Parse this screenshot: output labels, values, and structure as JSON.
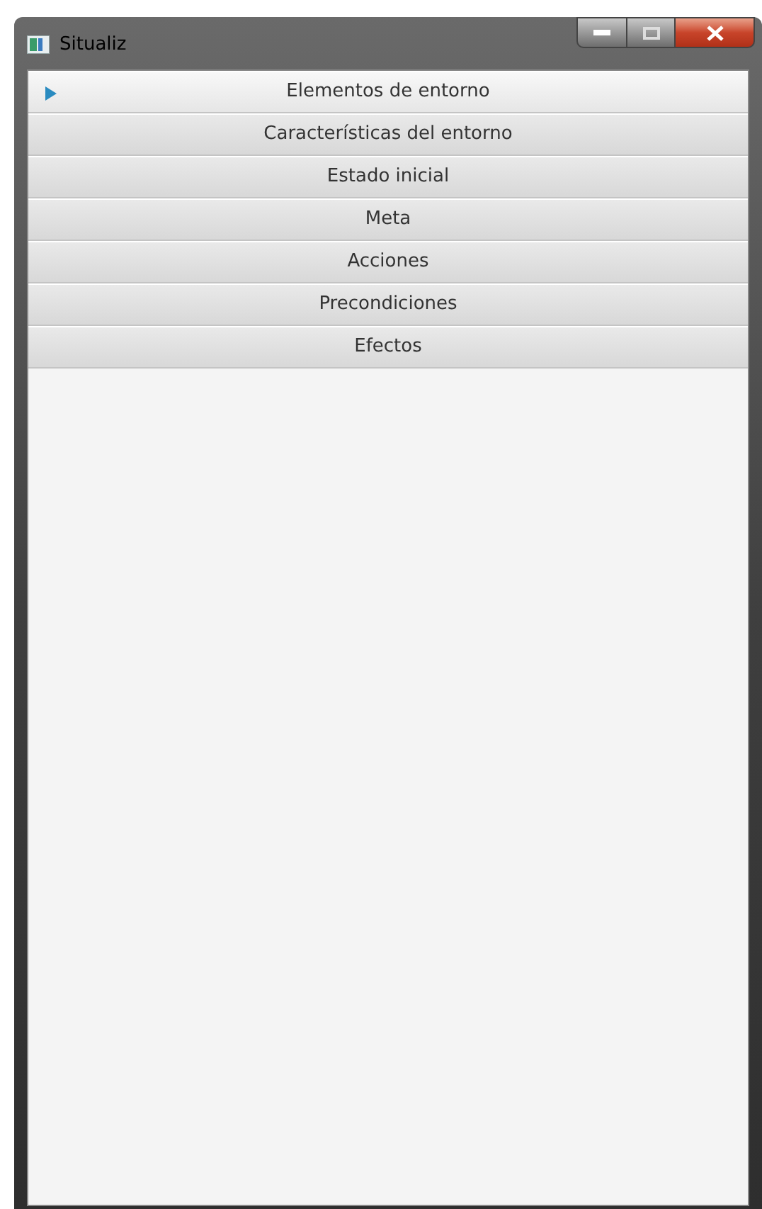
{
  "window": {
    "title": "Situaliz"
  },
  "panes": [
    {
      "label": "Elementos de entorno",
      "selected": true
    },
    {
      "label": "Características del entorno",
      "selected": false
    },
    {
      "label": "Estado inicial",
      "selected": false
    },
    {
      "label": "Meta",
      "selected": false
    },
    {
      "label": "Acciones",
      "selected": false
    },
    {
      "label": "Precondiciones",
      "selected": false
    },
    {
      "label": "Efectos",
      "selected": false
    }
  ]
}
